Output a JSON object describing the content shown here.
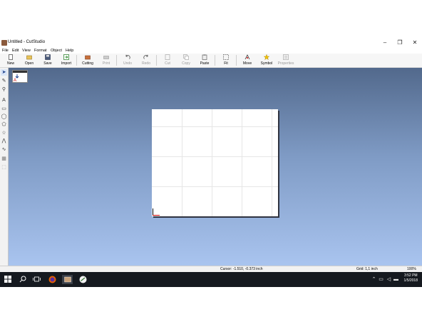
{
  "window": {
    "title": "Untitled - CutStudio",
    "minimize": "–",
    "restore": "❐",
    "close": "✕"
  },
  "menus": [
    "File",
    "Edit",
    "View",
    "Format",
    "Object",
    "Help"
  ],
  "toolbar": [
    {
      "label": "New",
      "icon": "new-document-icon",
      "enabled": true
    },
    {
      "label": "Open",
      "icon": "open-folder-icon",
      "enabled": true
    },
    {
      "label": "Save",
      "icon": "floppy-disk-icon",
      "enabled": true
    },
    {
      "label": "Import",
      "icon": "import-icon",
      "enabled": true
    },
    {
      "label": "Cutting",
      "icon": "cutting-plotter-icon",
      "enabled": true
    },
    {
      "label": "Print",
      "icon": "printer-icon",
      "enabled": false
    },
    {
      "label": "Undo",
      "icon": "undo-icon",
      "enabled": false
    },
    {
      "label": "Redo",
      "icon": "redo-icon",
      "enabled": false
    },
    {
      "label": "Cut",
      "icon": "scissors-icon",
      "enabled": false
    },
    {
      "label": "Copy",
      "icon": "copy-icon",
      "enabled": false
    },
    {
      "label": "Paste",
      "icon": "paste-icon",
      "enabled": true
    },
    {
      "label": "Fit",
      "icon": "fit-to-window-icon",
      "enabled": true
    },
    {
      "label": "Move",
      "icon": "move-icon",
      "enabled": true
    },
    {
      "label": "Symbol",
      "icon": "star-symbol-icon",
      "enabled": true
    },
    {
      "label": "Properties",
      "icon": "properties-icon",
      "enabled": false
    }
  ],
  "tools": [
    {
      "name": "select-arrow-tool-icon",
      "glyph": "➤"
    },
    {
      "name": "node-edit-tool-icon",
      "glyph": "✎"
    },
    {
      "name": "zoom-tool-icon",
      "glyph": "⚲"
    },
    {
      "name": "text-tool-icon",
      "glyph": "A"
    },
    {
      "name": "rectangle-tool-icon",
      "glyph": "▭"
    },
    {
      "name": "ellipse-tool-icon",
      "glyph": "◯"
    },
    {
      "name": "polygon-tool-icon",
      "glyph": "⬠"
    },
    {
      "name": "star-tool-icon",
      "glyph": "☆"
    },
    {
      "name": "polyline-tool-icon",
      "glyph": "⋀"
    },
    {
      "name": "freehand-tool-icon",
      "glyph": "∿"
    },
    {
      "name": "fill-tool-icon",
      "glyph": "▦"
    },
    {
      "name": "grid-tool-icon",
      "glyph": "⬚"
    }
  ],
  "status": {
    "cursor": "Cursor: -1.510, -0.373 inch",
    "grid": "Grid: 1,1 inch",
    "zoom": "100%"
  },
  "taskbar": {
    "time": "3:52 PM",
    "date": "1/5/2018"
  },
  "colors": {
    "canvas_top": "#52698c",
    "canvas_bottom": "#a9c4ef",
    "taskbar": "#15191f"
  }
}
